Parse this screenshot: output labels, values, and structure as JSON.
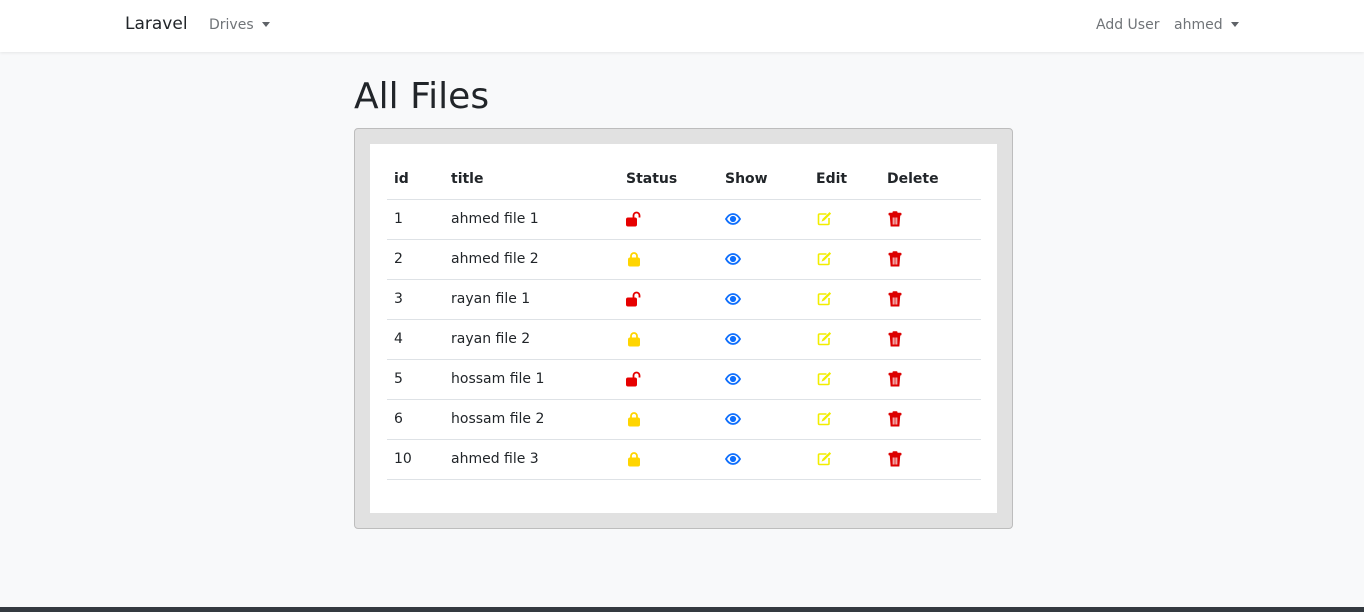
{
  "navbar": {
    "brand": "Laravel",
    "drives_label": "Drives",
    "add_user_label": "Add User",
    "user_label": "ahmed"
  },
  "page": {
    "title": "All Files"
  },
  "table": {
    "headers": [
      "id",
      "title",
      "Status",
      "Show",
      "Edit",
      "Delete"
    ],
    "rows": [
      {
        "id": "1",
        "title": "ahmed file 1",
        "status": "unlocked"
      },
      {
        "id": "2",
        "title": "ahmed file 2",
        "status": "locked"
      },
      {
        "id": "3",
        "title": "rayan file 1",
        "status": "unlocked"
      },
      {
        "id": "4",
        "title": "rayan file 2",
        "status": "locked"
      },
      {
        "id": "5",
        "title": "hossam file 1",
        "status": "unlocked"
      },
      {
        "id": "6",
        "title": "hossam file 2",
        "status": "locked"
      },
      {
        "id": "10",
        "title": "ahmed file 3",
        "status": "locked"
      }
    ]
  },
  "icons": {
    "status_unlocked": "unlock-icon",
    "status_locked": "lock-icon",
    "show": "eye-icon",
    "edit": "edit-icon",
    "delete": "trash-icon"
  },
  "colors": {
    "unlocked": "#e60000",
    "locked": "#ffd500",
    "show": "#0d6efd",
    "edit": "#f2ee00",
    "delete": "#dc0000"
  }
}
